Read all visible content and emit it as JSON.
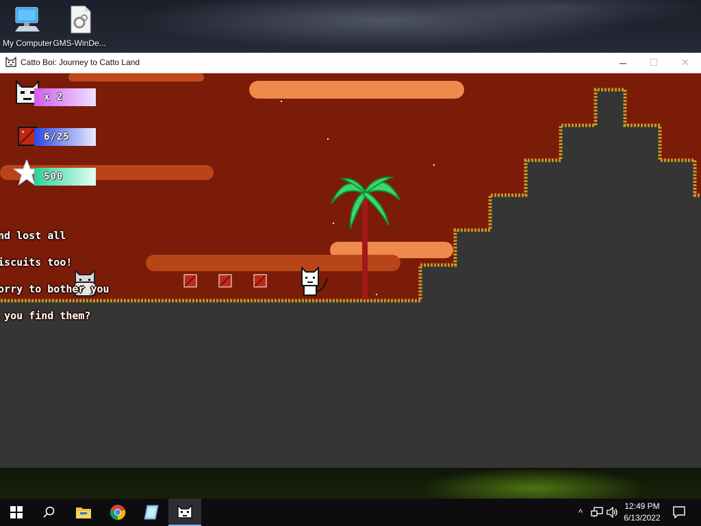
{
  "desktop": {
    "icons": [
      {
        "label": "My Computer",
        "icon": "computer-icon"
      },
      {
        "label": "GMS-WinDe...",
        "icon": "settings-file-icon"
      }
    ]
  },
  "window": {
    "title": "Catto Boi: Journey to Catto Land",
    "controls": {
      "minimize": "─",
      "maximize": "☐",
      "close": "✕"
    }
  },
  "game": {
    "hud": {
      "lives": "x 2",
      "biscuits": "6/25",
      "score": "500"
    },
    "dialog_lines": [
      "and lost all",
      "biscuits too!",
      "sorry to bother you",
      "n you find them?"
    ],
    "colors": {
      "sky": "#7a1c08",
      "ground": "#353535",
      "grass": "#c8961e",
      "cloud": "#e2743a",
      "palm_leaf": "#39d86a",
      "palm_trunk": "#a01818",
      "biscuit": "#c02818"
    }
  },
  "taskbar": {
    "apps": [
      {
        "icon": "windows-start-icon"
      },
      {
        "icon": "search-icon"
      },
      {
        "icon": "file-explorer-icon"
      },
      {
        "icon": "chrome-icon"
      },
      {
        "icon": "gamemaker-icon"
      },
      {
        "icon": "catto-boi-icon"
      }
    ],
    "tray": {
      "chevron": "^",
      "network": "network-icon",
      "volume": "volume-icon"
    },
    "clock": {
      "time": "12:49 PM",
      "date": "6/13/2022"
    }
  }
}
